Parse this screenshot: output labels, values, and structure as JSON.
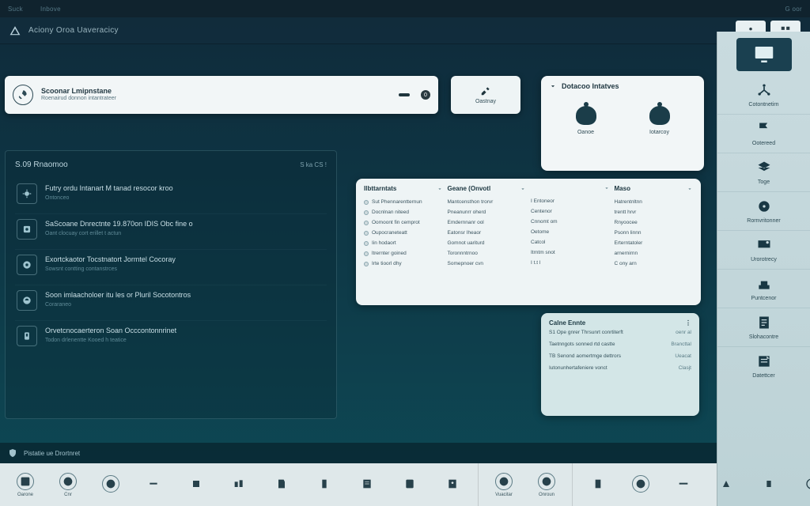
{
  "topbar": {
    "items": [
      "Suck",
      "Inbove"
    ],
    "right": "G oor"
  },
  "titlestrip": {
    "text": "Aciony Oroa Uaveracicy"
  },
  "search": {
    "title": "Scoonar Lmipnstane",
    "subtitle": "Roenairud donnon intantrateer",
    "badge": "0"
  },
  "minibutton": {
    "label": "Oastnay"
  },
  "detected": {
    "title": "Dotacoo Intatves",
    "items": [
      {
        "label": "Oanoe"
      },
      {
        "label": "Iotarcoy"
      }
    ]
  },
  "feed": {
    "title": "S.09 Rnaomoo",
    "meta": "S ka  CS !",
    "items": [
      {
        "title": "Futry ordu Intanart M tanad resocor kroo",
        "sub": "Ontonceo"
      },
      {
        "title": "SaScoane Dnrectnte 19.870on IDIS Obc fine o",
        "sub": "Oant clocuay cort erillet t actun"
      },
      {
        "title": "Exortckaotor Tocstnatort Jormtel Cocoray",
        "sub": "Sowsnt contting contanstrces"
      },
      {
        "title": "Soon imlaacholoer itu les or Pluril   Socotontros",
        "sub": "Coraraneo"
      },
      {
        "title": "Orvetcnocaerteron   Soan Occcontonnrinet",
        "sub": "Todon drlenentte    Kooed h teatice"
      }
    ]
  },
  "table": {
    "cols": [
      {
        "header": "Ilbttarntats",
        "rows": [
          "Sut Phennarentternun",
          "Docnlnan niteed",
          "Oomoont fin cemprot",
          "Oupocraneteatt",
          "Iin hodaort",
          "ltrernter goined",
          "Irte tioorl dhy"
        ]
      },
      {
        "header": "Geane (Onvotl",
        "rows": [
          "Mantcensthon trorvr",
          "Pneanunrr oherd",
          "Emdernnanr ool",
          "Eatonsr Iheaor",
          "Gomnot uariturd",
          "Toronnntrnoo",
          "Somepnoer cvn"
        ]
      },
      {
        "header": "",
        "rows": [
          "I Entoneor",
          "Centenor",
          "Cnnomt om",
          "Oetome",
          "Catcol",
          "Itrntm snot",
          "I t.t l"
        ]
      },
      {
        "header": "Maso",
        "rows": [
          "Hatrentnltnn",
          "trentt hrvr",
          "Rnyoocee",
          "Psonn linnn",
          "Erterntatoler",
          "arnernirnn",
          "C ony arn"
        ]
      }
    ]
  },
  "events": {
    "title": "Calne Ennte",
    "rows": [
      {
        "t": "S1 Ope gnrer Thrsunrt conrtiterft",
        "d": "oenr al"
      },
      {
        "t": "Taetnngots sonned rtd castte",
        "d": "Brancttal"
      },
      {
        "t": "TB Senond aomertmge dettrors",
        "d": "Ueacat"
      },
      {
        "t": "Iutonunhertafeniere vonct",
        "d": "Clasjt"
      }
    ]
  },
  "rail": {
    "items": [
      {
        "label": "Cotontnetirn"
      },
      {
        "label": "Ootereed"
      },
      {
        "label": "Toge"
      },
      {
        "label": "Rornvritonner"
      },
      {
        "label": "Urorotrecy"
      },
      {
        "label": "Puntcenor"
      },
      {
        "label": "Slohacontre"
      },
      {
        "label": "Datettcer"
      }
    ]
  },
  "footer_alert": "Pistatie ue  Drortnret",
  "toolbar": {
    "groups": [
      [
        {
          "l": "Oarone"
        },
        {
          "l": "Cnr"
        },
        {
          "l": ""
        },
        {
          "l": ""
        },
        {
          "l": ""
        },
        {
          "l": ""
        },
        {
          "l": ""
        },
        {
          "l": ""
        },
        {
          "l": ""
        },
        {
          "l": ""
        },
        {
          "l": ""
        }
      ],
      [
        {
          "l": "Vuacitar"
        },
        {
          "l": "Onroun"
        }
      ],
      [
        {
          "l": ""
        },
        {
          "l": ""
        },
        {
          "l": ""
        },
        {
          "l": ""
        },
        {
          "l": ""
        },
        {
          "l": ""
        },
        {
          "l": ""
        },
        {
          "l": ""
        }
      ]
    ]
  }
}
